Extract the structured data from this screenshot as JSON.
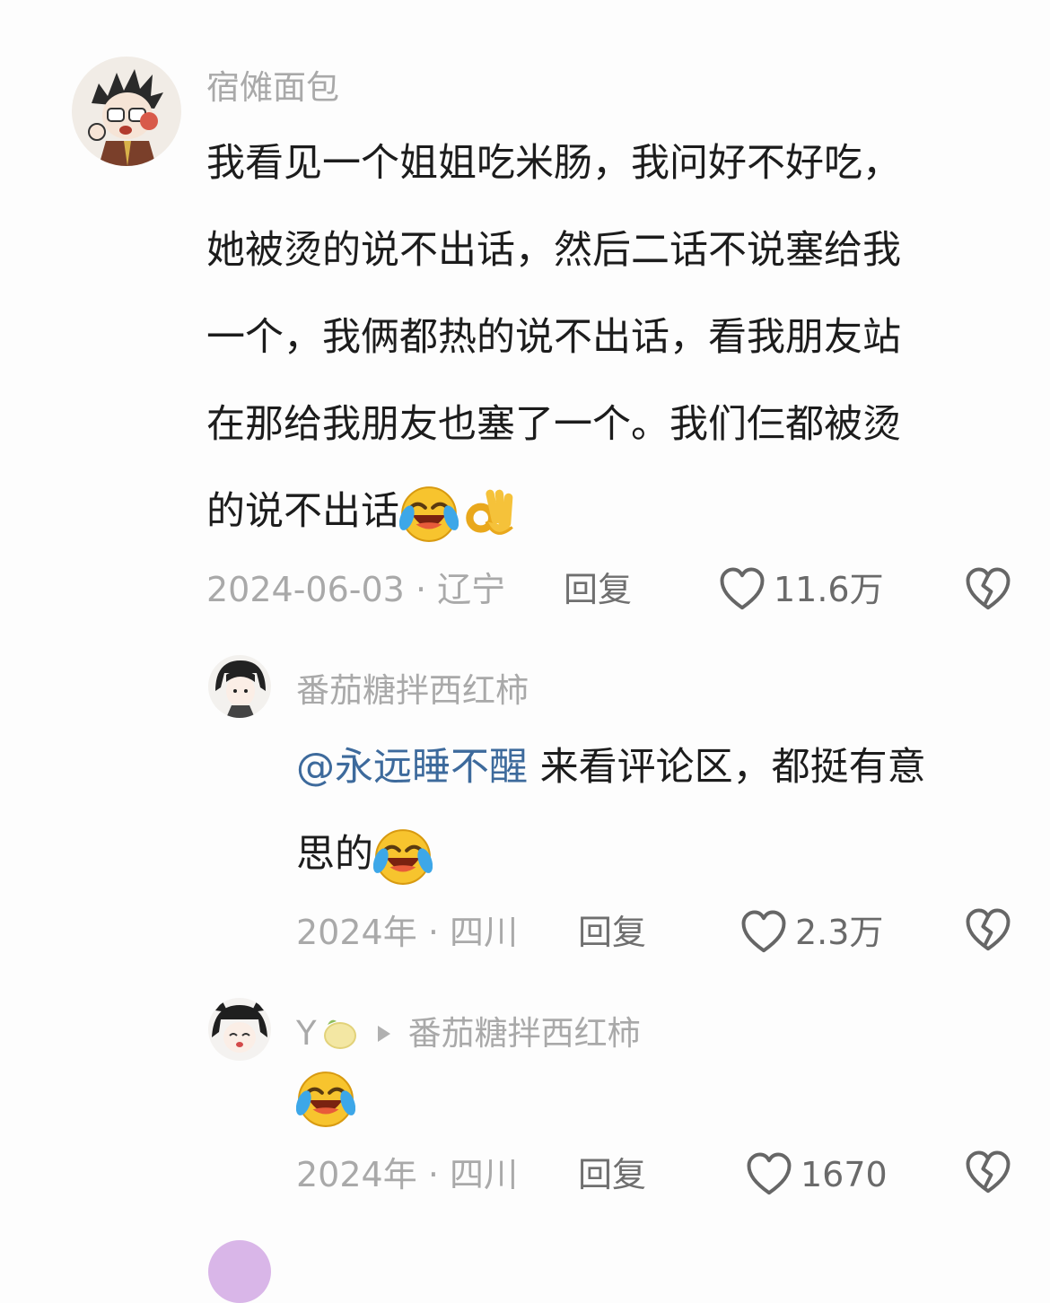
{
  "comments": [
    {
      "username": "宿傩面包",
      "text_lines": [
        "我看见一个姐姐吃米肠，我问好不好吃，",
        "她被烫的说不出话，然后二话不说塞给我",
        "一个，我俩都热的说不出话，看我朋友站",
        "在那给我朋友也塞了一个。我们仨都被烫",
        "的说不出话"
      ],
      "emojis": [
        "laughing-crying",
        "ok-hand"
      ],
      "date": "2024-06-03",
      "location": "辽宁",
      "reply_label": "回复",
      "likes": "11.6万"
    },
    {
      "username": "番茄糖拌西红柿",
      "mention": "@永远睡不醒",
      "text_line1_rest": " 来看评论区，都挺有意",
      "text_line2": "思的",
      "emojis": [
        "laughing-crying"
      ],
      "date": "2024年",
      "location": "四川",
      "reply_label": "回复",
      "likes": "2.3万"
    },
    {
      "username": "Y",
      "reply_to": "番茄糖拌西红柿",
      "emojis": [
        "laughing-crying"
      ],
      "date": "2024年",
      "location": "四川",
      "reply_label": "回复",
      "likes": "1670"
    }
  ],
  "separator": "·",
  "colors": {
    "meta": "#a9a9a9",
    "mention": "#3d6a9c",
    "text": "#1c1c1c"
  }
}
